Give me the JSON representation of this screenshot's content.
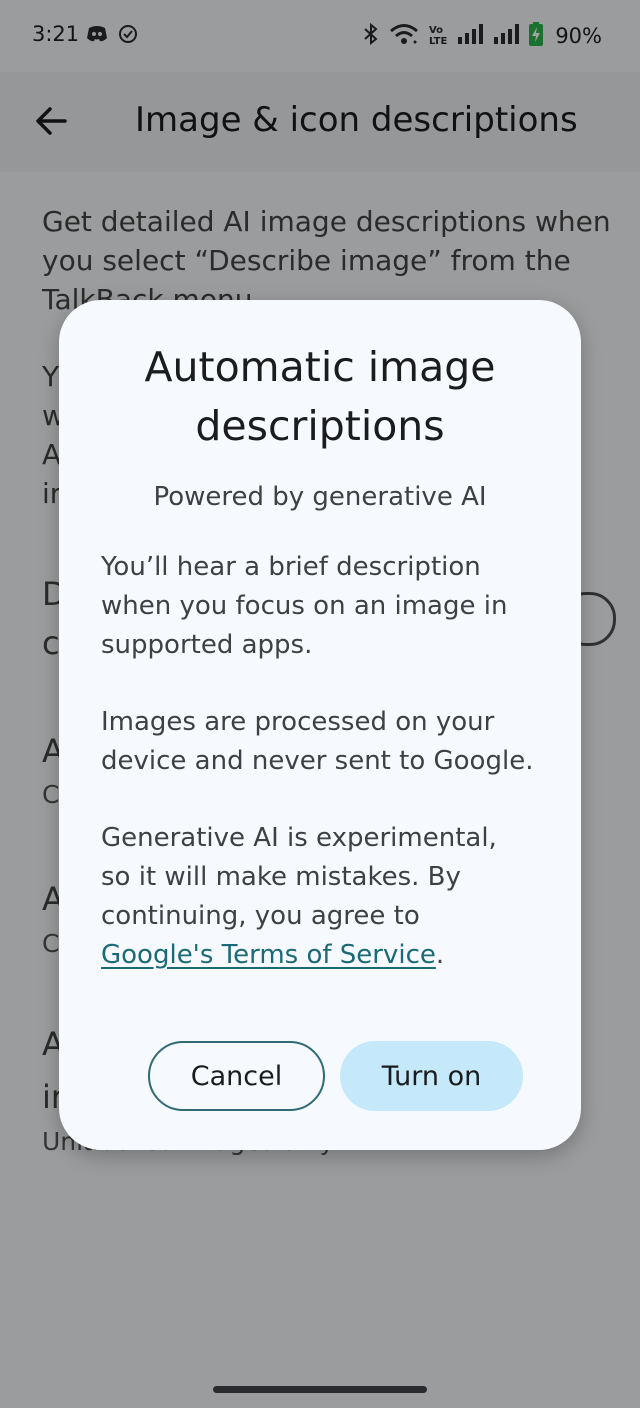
{
  "status_bar": {
    "time": "3:21",
    "battery": "90%",
    "network_label_top": "Vo",
    "network_label_bottom": "LTE",
    "icons": [
      "discord-icon",
      "check-circle-icon",
      "bluetooth-icon",
      "wifi-icon",
      "volte-icon",
      "signal-icon",
      "signal-icon",
      "battery-charging-icon"
    ]
  },
  "app_bar": {
    "title": "Image & icon descriptions",
    "back_icon": "arrow-left-icon"
  },
  "background": {
    "intro_line1": "Get detailed AI image descriptions when",
    "intro_line2": "you select “Describe image” from the",
    "intro_line3": "TalkBack menu.",
    "para2_fragments": [
      "Y",
      "w",
      "A",
      "ir"
    ],
    "item1_fragments": [
      "D",
      "c"
    ],
    "item2_fragments": [
      "A",
      "C"
    ],
    "item3_fragments": [
      "A",
      "C"
    ],
    "item4_fragments": [
      "A",
      "ir"
    ],
    "item4_subtitle": "Unlabelled images only"
  },
  "dialog": {
    "title_line1": "Automatic image",
    "title_line2": "descriptions",
    "subtitle": "Powered by generative AI",
    "para1": [
      "You’ll hear a brief description",
      "when you focus on an image in",
      "supported apps."
    ],
    "para2": [
      "Images are processed on your",
      "device and never sent to Google."
    ],
    "para3": [
      "Generative AI is experimental,",
      "so it will make mistakes. By",
      "continuing, you agree to"
    ],
    "tos_link": "Google's Terms of Service",
    "tos_period": ".",
    "cancel_label": "Cancel",
    "confirm_label": "Turn on"
  },
  "colors": {
    "accent_link": "#1a6a78",
    "primary_button_bg": "#c5e8fb",
    "outline_button_border": "#2f6b74",
    "battery_charging": "#2bb14c"
  }
}
